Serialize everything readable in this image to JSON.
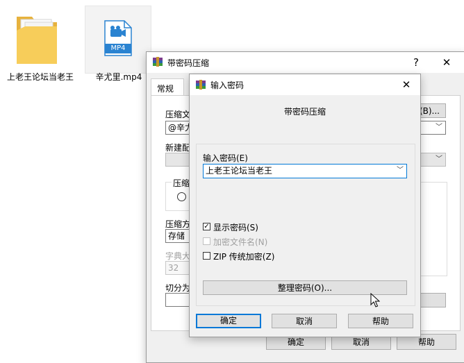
{
  "desktop": {
    "folder": {
      "label": "上老王论坛当老王"
    },
    "file": {
      "label": "辛尤里.mp4",
      "badge": "MP4"
    }
  },
  "archive_dialog": {
    "title": "带密码压缩",
    "help_btn": "?",
    "close_btn": "✕",
    "tab": "常规",
    "archive_name_label": "压缩文",
    "archive_name_value": "@辛尤",
    "browse_label": "(B)...",
    "profile_label": "新建配",
    "format_group": "压缩",
    "method_label": "压缩方",
    "method_value": "存储",
    "dict_label": "字典大",
    "dict_value": "32",
    "split_label": "切分为",
    "ok": "确定",
    "cancel": "取消",
    "help": "帮助"
  },
  "password_dialog": {
    "title": "输入密码",
    "close_btn": "✕",
    "heading": "带密码压缩",
    "password_label": "输入密码(E)",
    "password_value": "上老王论坛当老王",
    "show_password": "显示密码(S)",
    "encrypt_names": "加密文件名(N)",
    "zip_legacy": "ZIP 传统加密(Z)",
    "organize": "整理密码(O)...",
    "ok": "确定",
    "cancel": "取消",
    "help": "帮助",
    "checks": {
      "show_password": true,
      "encrypt_names": false,
      "zip_legacy": false
    }
  },
  "colors": {
    "accent": "#0078d7",
    "folder": "#f5c84c",
    "mp4_icon": "#2a83d1"
  }
}
